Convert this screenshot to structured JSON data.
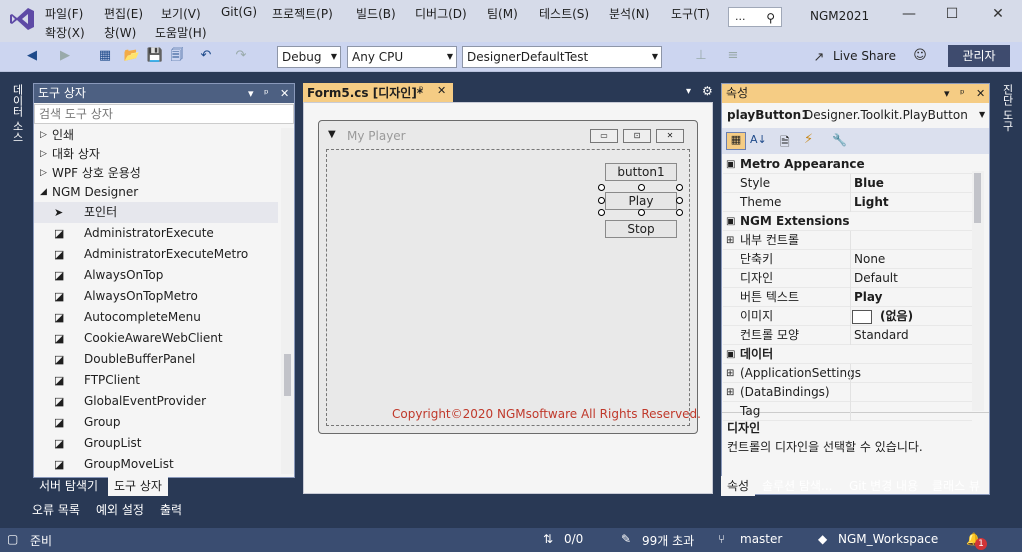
{
  "menu": {
    "row1": [
      "파일(F)",
      "편집(E)",
      "보기(V)",
      "Git(G)",
      "프로젝트(P)",
      "빌드(B)",
      "디버그(D)",
      "팀(M)",
      "테스트(S)",
      "분석(N)",
      "도구(T)"
    ],
    "row2": [
      "확장(X)",
      "창(W)",
      "도움말(H)"
    ]
  },
  "title": {
    "search_text": "...",
    "solution_name": "NGM2021"
  },
  "toolbar": {
    "config": "Debug",
    "platform": "Any CPU",
    "startup": "DesignerDefaultTest",
    "live_share": "Live Share",
    "admin": "관리자"
  },
  "left_strip": {
    "tab": "데이터 소스"
  },
  "right_strip": {
    "tab": "진단 도구"
  },
  "toolbox": {
    "title": "도구 상자",
    "search_placeholder": "검색 도구 상자",
    "groups": [
      "인쇄",
      "대화 상자",
      "WPF 상호 운용성",
      "NGM Designer"
    ],
    "items": [
      "포인터",
      "AdministratorExecute",
      "AdministratorExecuteMetro",
      "AlwaysOnTop",
      "AlwaysOnTopMetro",
      "AutocompleteMenu",
      "CookieAwareWebClient",
      "DoubleBufferPanel",
      "FTPClient",
      "GlobalEventProvider",
      "Group",
      "GroupList",
      "GroupMoveList"
    ],
    "bottom_tabs": [
      "서버 탐색기",
      "도구 상자"
    ],
    "bottom_tools": [
      "오류 목록",
      "예외 설정",
      "출력"
    ]
  },
  "editor": {
    "tab": "Form5.cs [디자인]*",
    "form_title": "My Player",
    "buttons": [
      "button1",
      "Play",
      "Stop"
    ],
    "copyright": "Copyright©2020 NGMsoftware All Rights Reserved."
  },
  "properties": {
    "title": "속성",
    "object_name": "playButton1",
    "object_type": "Designer.Toolkit.PlayButton",
    "rows": [
      {
        "kind": "cat",
        "name": "Metro Appearance",
        "value": ""
      },
      {
        "kind": "prop",
        "name": "Style",
        "value": "Blue",
        "bold": true
      },
      {
        "kind": "prop",
        "name": "Theme",
        "value": "Light",
        "bold": true
      },
      {
        "kind": "cat",
        "name": "NGM Extensions",
        "value": ""
      },
      {
        "kind": "exp",
        "name": "내부 컨트롤",
        "value": ""
      },
      {
        "kind": "prop",
        "name": "단축키",
        "value": "None"
      },
      {
        "kind": "prop",
        "name": "디자인",
        "value": "Default"
      },
      {
        "kind": "prop",
        "name": "버튼 텍스트",
        "value": "Play",
        "bold": true
      },
      {
        "kind": "img",
        "name": "이미지",
        "value": "(없음)",
        "bold": true
      },
      {
        "kind": "prop",
        "name": "컨트롤 모양",
        "value": "Standard"
      },
      {
        "kind": "cat",
        "name": "데이터",
        "value": ""
      },
      {
        "kind": "exp",
        "name": "(ApplicationSettings",
        "value": ""
      },
      {
        "kind": "exp",
        "name": "(DataBindings)",
        "value": ""
      },
      {
        "kind": "prop",
        "name": "Tag",
        "value": ""
      }
    ],
    "desc_title": "디자인",
    "desc_text": "컨트롤의 디자인을 선택할 수 있습니다.",
    "bottom_tabs": [
      "속성",
      "솔루션 탐색...",
      "Git 변경 내용",
      "클래스 뷰"
    ]
  },
  "status": {
    "ready": "준비",
    "updown": "0/0",
    "pending": "99개 초과",
    "branch": "master",
    "workspace": "NGM_Workspace",
    "notifications": "1"
  }
}
